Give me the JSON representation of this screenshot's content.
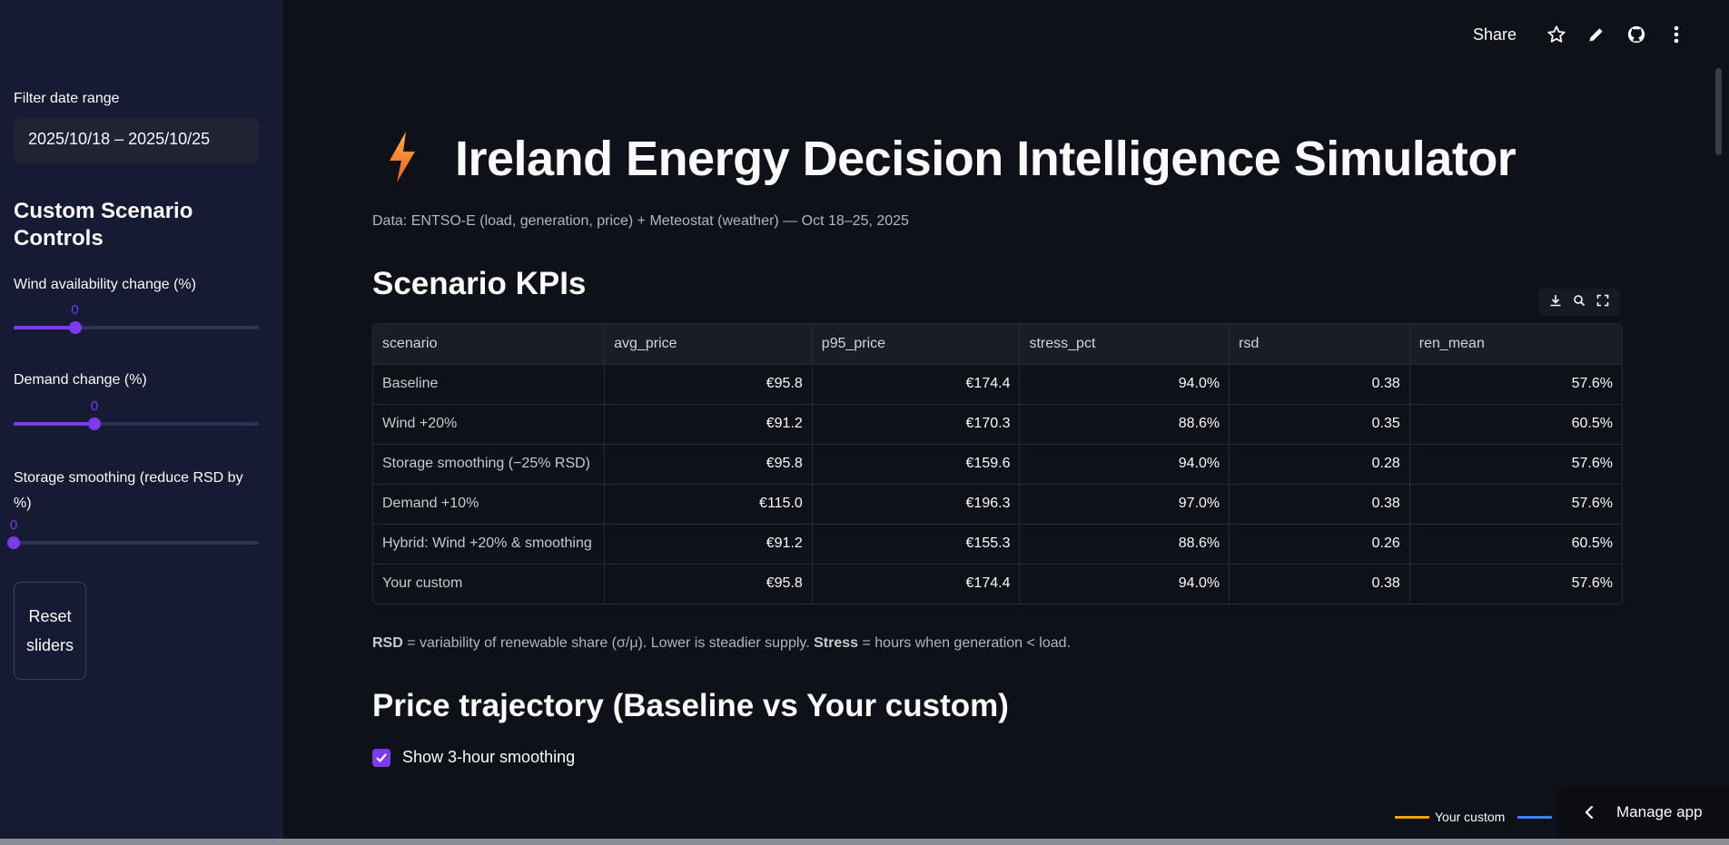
{
  "sidebar": {
    "date_label": "Filter date range",
    "date_value": "2025/10/18 – 2025/10/25",
    "heading": "Custom Scenario Controls",
    "sliders": [
      {
        "label": "Wind availability change (%)",
        "value": "0",
        "fraction": 0.25
      },
      {
        "label": "Demand change (%)",
        "value": "0",
        "fraction": 0.33
      },
      {
        "label": "Storage smoothing (reduce RSD by %)",
        "value": "0",
        "fraction": 0.0
      }
    ],
    "reset_label": "Reset sliders"
  },
  "toolbar": {
    "share_label": "Share",
    "icons": [
      "star-icon",
      "pencil-icon",
      "github-icon",
      "more-vertical-icon"
    ]
  },
  "main": {
    "title_icon": "lightning-bolt-icon",
    "title": "Ireland Energy Decision Intelligence Simulator",
    "subtitle": "Data: ENTSO-E (load, generation, price) + Meteostat (weather) — Oct 18–25, 2025",
    "kpi_heading": "Scenario KPIs",
    "table": {
      "columns": [
        "scenario",
        "avg_price",
        "p95_price",
        "stress_pct",
        "rsd",
        "ren_mean"
      ],
      "rows": [
        [
          "Baseline",
          "€95.8",
          "€174.4",
          "94.0%",
          "0.38",
          "57.6%"
        ],
        [
          "Wind +20%",
          "€91.2",
          "€170.3",
          "88.6%",
          "0.35",
          "60.5%"
        ],
        [
          "Storage smoothing (−25% RSD)",
          "€95.8",
          "€159.6",
          "94.0%",
          "0.28",
          "57.6%"
        ],
        [
          "Demand +10%",
          "€115.0",
          "€196.3",
          "97.0%",
          "0.38",
          "57.6%"
        ],
        [
          "Hybrid: Wind +20% & smoothing",
          "€91.2",
          "€155.3",
          "88.6%",
          "0.26",
          "60.5%"
        ],
        [
          "Your custom",
          "€95.8",
          "€174.4",
          "94.0%",
          "0.38",
          "57.6%"
        ]
      ]
    },
    "note": {
      "rsd_term": "RSD",
      "rsd_text": " = variability of renewable share (σ/μ). Lower is steadier supply. ",
      "stress_term": "Stress",
      "stress_text": " = hours when generation < load."
    },
    "price_heading": "Price trajectory (Baseline vs Your custom)",
    "checkbox_label": "Show 3-hour smoothing",
    "checkbox_checked": true,
    "legend": [
      {
        "label": "Your custom",
        "color": "#f59e0b"
      },
      {
        "label": "",
        "color": "#3b82f6"
      }
    ]
  },
  "manage_app_label": "Manage app",
  "colors": {
    "accent": "#7c3aed",
    "sidebar_bg": "#161b33",
    "main_bg": "#0e1117"
  }
}
